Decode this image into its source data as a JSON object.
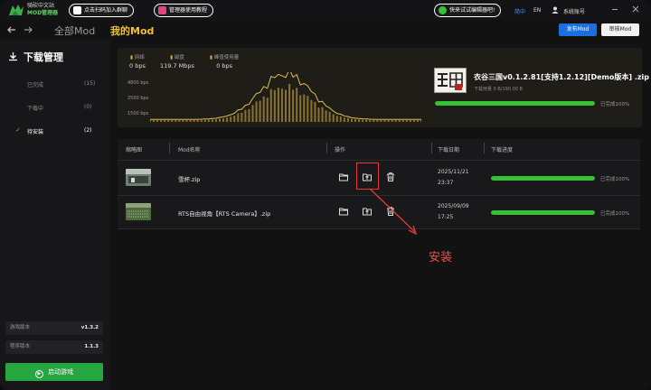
{
  "app": {
    "logo_title": "骑砍中文站",
    "logo_subtitle": "MOD管理器",
    "pill_group": "点击扫码加入群聊",
    "pill_tutorial": "管理器使用教程",
    "pill_trial": "快来试试编辑器吧!",
    "lang_zh": "简中",
    "lang_en": "EN",
    "account": "系统账号",
    "brand_green": "#35c234",
    "accent_blue": "#1c6fe0"
  },
  "nav": {
    "back_icon": "arrow-left-icon",
    "forward_icon": "arrow-right-icon",
    "tab_all": "全部Mod",
    "tab_mine": "我的Mod",
    "publish_button": "发布Mod",
    "review_button": "审核Mod"
  },
  "sidebar": {
    "heading": "下载管理",
    "items": [
      {
        "label": "已完成",
        "count": "(15)"
      },
      {
        "label": "下载中",
        "count": "(0)"
      },
      {
        "label": "待安装",
        "count": "(2)"
      }
    ],
    "game_version_label": "游戏版本",
    "game_version": "v1.3.2",
    "manager_version_label": "程序版本",
    "manager_version": "1.1.3",
    "start_button": "启动游戏"
  },
  "stats": {
    "network_label": "网络",
    "network_value": "0 bps",
    "disk_label": "磁盘",
    "disk_value": "119.7 Mbps",
    "disk_peak_label": "峰值使用量",
    "disk_peak_value": "0 bps",
    "y_ticks": [
      "4800 bps",
      "2500 bps",
      "1500 bps"
    ]
  },
  "current_download": {
    "title": "衣谷三国v0.1.2.81[支持1.2.12][Demo版本] .zip",
    "size": "下载用量 0 B/190.00 B",
    "progress": 1.0,
    "status": "已完成100%"
  },
  "table": {
    "headers": [
      "缩略图",
      "Mod名称",
      "操作",
      "下载日期",
      "下载进度"
    ],
    "rows": [
      {
        "name": "雪杯.zip",
        "date": "2025/11/21",
        "time": "23:37",
        "progress": 1.0,
        "status": "已完成100%"
      },
      {
        "name": "RTS自由视角【RTS Camera】.zip",
        "date": "2025/09/09",
        "time": "17:25",
        "progress": 1.0,
        "status": "已完成100%"
      }
    ]
  },
  "annotation": {
    "label": "安装"
  }
}
